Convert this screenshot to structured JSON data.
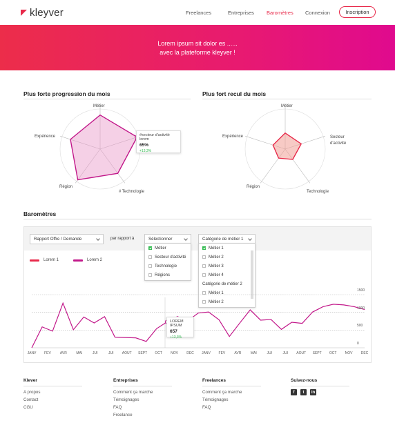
{
  "brand": {
    "name": "kleyver"
  },
  "nav": {
    "items": [
      "Freelances",
      "Entreprises",
      "Baromètres",
      "Connexion"
    ],
    "active": "Baromètres",
    "cta": "Inscription"
  },
  "hero": {
    "line1": "Lorem ipsum sit dolor es ......",
    "line2": "avec  la plateforme kleyver !"
  },
  "progression": {
    "title": "Plus forte progression du mois",
    "axes": [
      "Métier",
      "Secteur d'activité",
      "# Technologie",
      "Région",
      "Expérience"
    ],
    "tooltip": {
      "label": "#secteur d'activité lorem",
      "value": "65%",
      "delta": "+13,3%"
    },
    "values": [
      0.85,
      0.97,
      0.75,
      0.95,
      0.78
    ]
  },
  "recul": {
    "title": "Plus fort recul du mois",
    "axes": [
      "Métier",
      "Secteur\nd'activité",
      "Technologie",
      "Région",
      "Expérience"
    ],
    "values": [
      0.4,
      0.42,
      0.32,
      0.28,
      0.32
    ]
  },
  "barometres": {
    "title": "Baromètres",
    "select1": "Rapport Offre / Demande",
    "par_rapport": "par rapport à",
    "select2": {
      "value": "Sélectionner",
      "options": [
        {
          "label": "Métier",
          "checked": true
        },
        {
          "label": "Secteur d'activité",
          "checked": false
        },
        {
          "label": "Technologie",
          "checked": false
        },
        {
          "label": "Régions",
          "checked": false
        }
      ]
    },
    "select3": {
      "value": "Catégorie de métier 1",
      "groups": [
        {
          "label": "Catégorie de métier 1",
          "options": [
            {
              "label": "Métier 1",
              "checked": true
            },
            {
              "label": "Métier 2",
              "checked": false
            },
            {
              "label": "Métier 3",
              "checked": false
            },
            {
              "label": "Métier 4",
              "checked": false
            }
          ]
        },
        {
          "label": "Catégorie de métier 2",
          "options": [
            {
              "label": "Métier 1",
              "checked": false
            },
            {
              "label": "Métier 2",
              "checked": false
            }
          ]
        }
      ]
    },
    "legend": [
      {
        "name": "Lorem 1",
        "color": "#e8294a"
      },
      {
        "name": "Lorem 2",
        "color": "#c2188a"
      }
    ],
    "tooltip": {
      "label": "LOREM IPSUM",
      "value": "657",
      "delta": "+13,3%"
    }
  },
  "chart_data": {
    "type": "line",
    "x": [
      "JANV",
      "FEV",
      "AVR",
      "MAI",
      "JUI",
      "JUI",
      "AOUT",
      "SEPT",
      "OCT",
      "NOV",
      "DEC",
      "JANV",
      "FEV",
      "AVR",
      "MAI",
      "JUI",
      "JUI",
      "AOUT",
      "SEPT",
      "OCT",
      "NOV",
      "DEC"
    ],
    "yticks": [
      "0",
      "500",
      "1000",
      "1500"
    ],
    "ylim": [
      0,
      1500
    ],
    "series": [
      {
        "name": "Lorem 2",
        "values": [
          0,
          590,
          470,
          1260,
          510,
          870,
          700,
          880,
          300,
          290,
          280,
          180,
          540,
          730,
          880,
          760,
          980,
          1010,
          790,
          320,
          700,
          1070,
          780,
          800,
          520,
          720,
          690,
          1010,
          1160,
          1230,
          1210,
          1160,
          1080
        ]
      }
    ],
    "grid": true,
    "legend_placement": "top-left"
  },
  "footer": {
    "columns": [
      {
        "title": "Klever",
        "links": [
          "A propos",
          "Contact",
          "CGU"
        ]
      },
      {
        "title": "Entreprises",
        "links": [
          "Comment ça marche",
          "Témoignages",
          "FAQ",
          "Freelance"
        ]
      },
      {
        "title": "Freelances",
        "links": [
          "Comment ça marche",
          "Témoignages",
          "FAQ"
        ]
      },
      {
        "title": "Suivez-nous",
        "icons": [
          "facebook-icon",
          "twitter-icon",
          "linkedin-icon"
        ]
      }
    ]
  }
}
